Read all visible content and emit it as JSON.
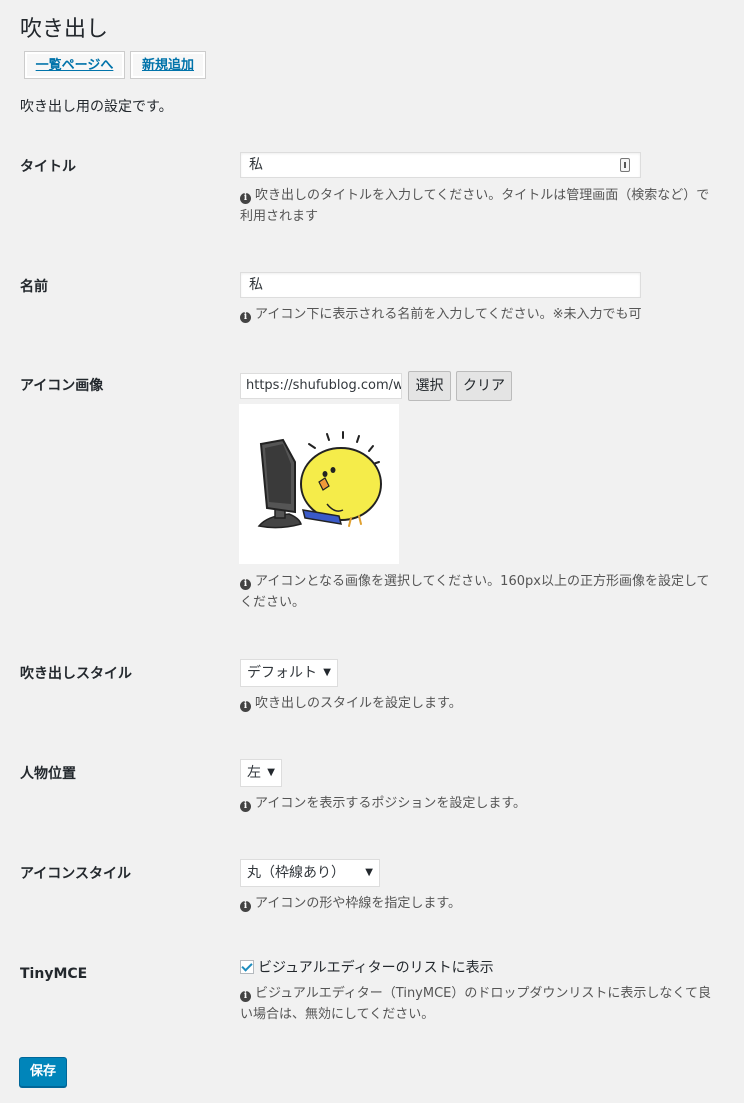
{
  "page": {
    "title": "吹き出し",
    "description": "吹き出し用の設定です。"
  },
  "nav": {
    "list_label": "一覧ページへ",
    "new_label": "新規追加"
  },
  "fields": {
    "title": {
      "label": "タイトル",
      "value": "私",
      "help": "吹き出しのタイトルを入力してください。タイトルは管理画面（検索など）で利用されます"
    },
    "name": {
      "label": "名前",
      "value": "私",
      "help": "アイコン下に表示される名前を入力してください。※未入力でも可"
    },
    "icon_image": {
      "label": "アイコン画像",
      "value": "https://shufublog.com/w",
      "select_label": "選択",
      "clear_label": "クリア",
      "help": "アイコンとなる画像を選択してください。160px以上の正方形画像を設定してください。"
    },
    "balloon_style": {
      "label": "吹き出しスタイル",
      "value": "デフォルト",
      "help": "吹き出しのスタイルを設定します。"
    },
    "position": {
      "label": "人物位置",
      "value": "左",
      "help": "アイコンを表示するポジションを設定します。"
    },
    "icon_style": {
      "label": "アイコンスタイル",
      "value": "丸（枠線あり）",
      "help": "アイコンの形や枠線を指定します。"
    },
    "tinymce": {
      "label": "TinyMCE",
      "checkbox_label": "ビジュアルエディターのリストに表示",
      "checked": true,
      "help": "ビジュアルエディター（TinyMCE）のドロップダウンリストに表示しなくて良い場合は、無効にしてください。"
    }
  },
  "save_label": "保存",
  "icons": {
    "info": "info-icon",
    "caret": "caret-down-icon",
    "ime": "ime-indicator-icon"
  },
  "colors": {
    "primary": "#0085ba",
    "link": "#0073aa",
    "background": "#f1f1f1",
    "chick_yellow": "#f5ec4a",
    "monitor": "#444444",
    "keyboard": "#3a5ac8"
  }
}
